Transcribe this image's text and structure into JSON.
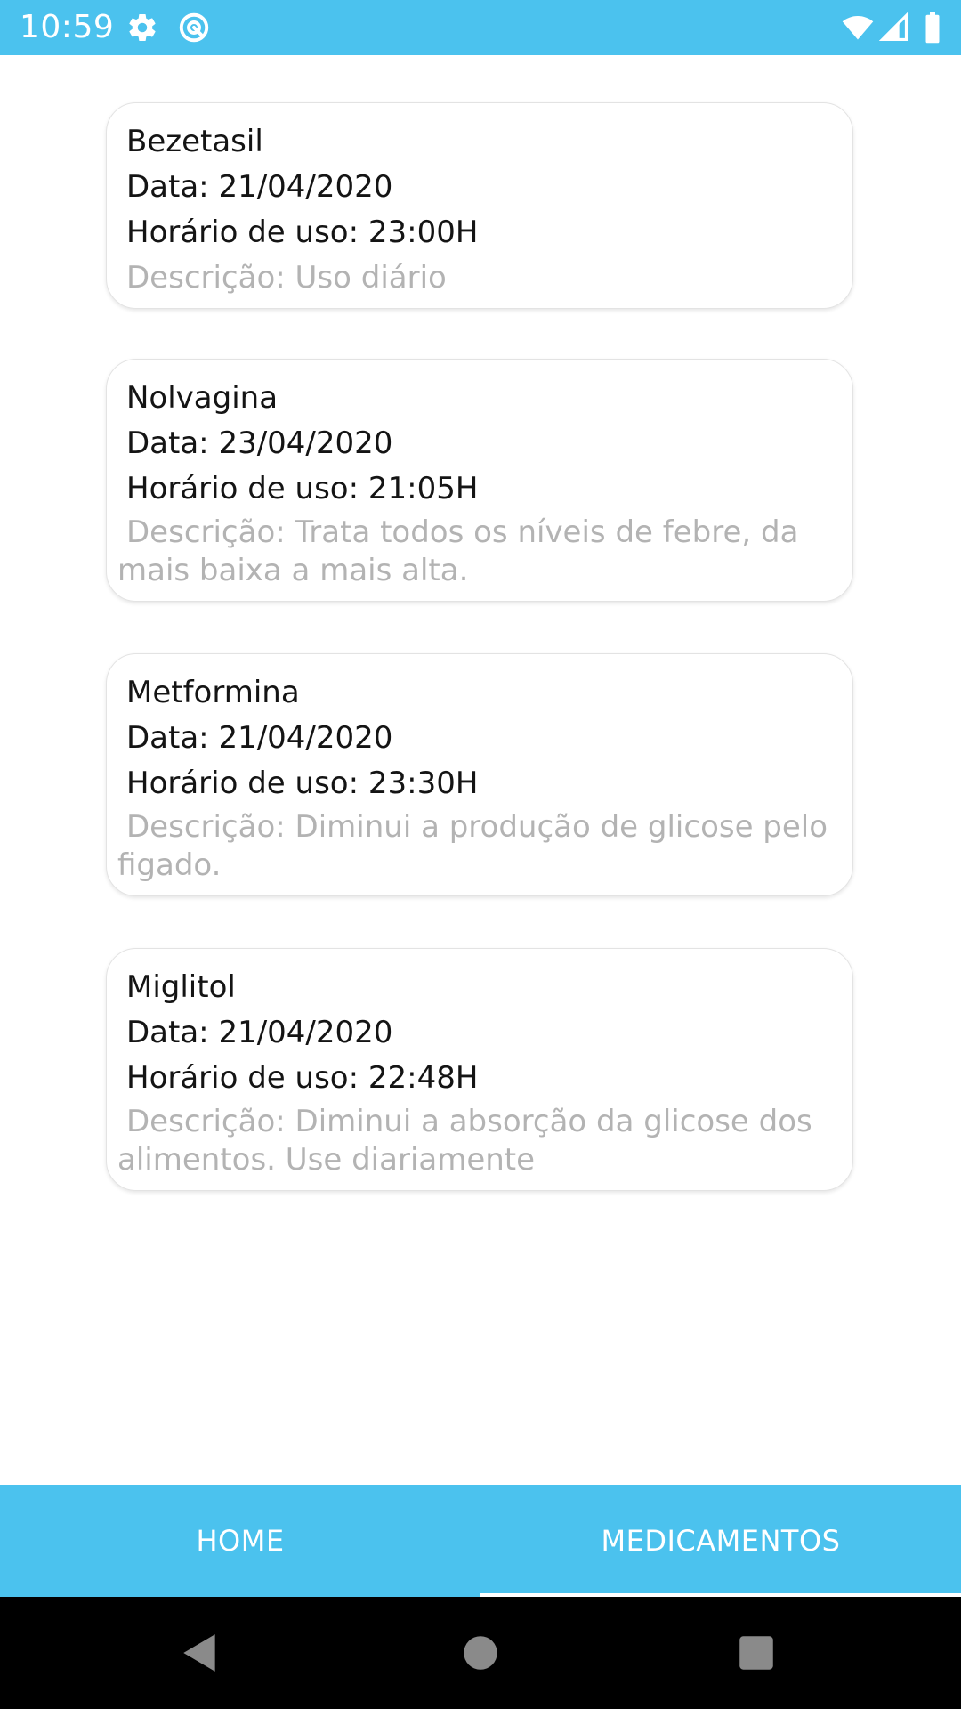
{
  "status_bar": {
    "time": "10:59",
    "left_icons": [
      "gear-icon",
      "at-sign-icon"
    ],
    "right_icons": [
      "wifi-icon",
      "cell-signal-icon",
      "battery-icon"
    ],
    "background_color": "#4bc2ee"
  },
  "medications": [
    {
      "name": "Bezetasil",
      "date": "Data: 21/04/2020",
      "time": "Horário de uso: 23:00H",
      "description": "Descrição: Uso diário"
    },
    {
      "name": "Nolvagina",
      "date": "Data: 23/04/2020",
      "time": "Horário de uso: 21:05H",
      "description": " Descrição: Trata todos os níveis de febre, da mais baixa a mais alta."
    },
    {
      "name": "Metformina",
      "date": "Data: 21/04/2020",
      "time": "Horário de uso: 23:30H",
      "description": " Descrição: Diminui a produção de glicose pelo figado."
    },
    {
      "name": "Miglitol",
      "date": "Data: 21/04/2020",
      "time": "Horário de uso: 22:48H",
      "description": " Descrição: Diminui a absorção da glicose dos alimentos. Use diariamente"
    }
  ],
  "tabs": [
    {
      "label": "HOME",
      "selected": false
    },
    {
      "label": "MEDICAMENTOS",
      "selected": true
    }
  ],
  "colors": {
    "accent": "#4bc2ee",
    "description_text": "#b3b3b3",
    "primary_text": "#141414"
  },
  "nav_bar": {
    "buttons": [
      "back-icon",
      "home-icon",
      "recents-icon"
    ]
  }
}
